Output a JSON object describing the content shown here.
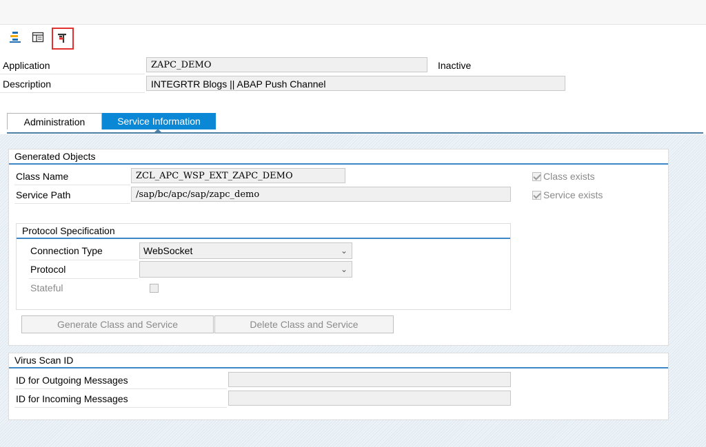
{
  "header": {
    "application_label": "Application",
    "application_value": "ZAPC_DEMO",
    "status": "Inactive",
    "description_label": "Description",
    "description_value": "INTEGRTR Blogs || ABAP Push Channel"
  },
  "toolbar": {
    "icons": [
      "hierarchy-icon",
      "display-layout-icon",
      "activate-icon"
    ]
  },
  "tabs": [
    {
      "label": "Administration",
      "selected": false
    },
    {
      "label": "Service Information",
      "selected": true
    }
  ],
  "generated_objects": {
    "title": "Generated Objects",
    "class_name_label": "Class Name",
    "class_name_value": "ZCL_APC_WSP_EXT_ZAPC_DEMO",
    "service_path_label": "Service Path",
    "service_path_value": "/sap/bc/apc/sap/zapc_demo",
    "class_exists_label": "Class exists",
    "service_exists_label": "Service exists",
    "class_exists_checked": true,
    "service_exists_checked": true
  },
  "protocol_spec": {
    "title": "Protocol Specification",
    "connection_type_label": "Connection Type",
    "connection_type_value": "WebSocket",
    "protocol_label": "Protocol",
    "protocol_value": "",
    "stateful_label": "Stateful"
  },
  "buttons": {
    "generate": "Generate Class and Service",
    "delete": "Delete Class and Service"
  },
  "virus_scan": {
    "title": "Virus Scan ID",
    "outgoing_label": "ID for Outgoing Messages",
    "outgoing_value": "",
    "incoming_label": "ID for Incoming Messages",
    "incoming_value": ""
  },
  "colors": {
    "accent": "#0a88d6",
    "section_line": "#3d86c6",
    "highlight": "#e0312f"
  }
}
